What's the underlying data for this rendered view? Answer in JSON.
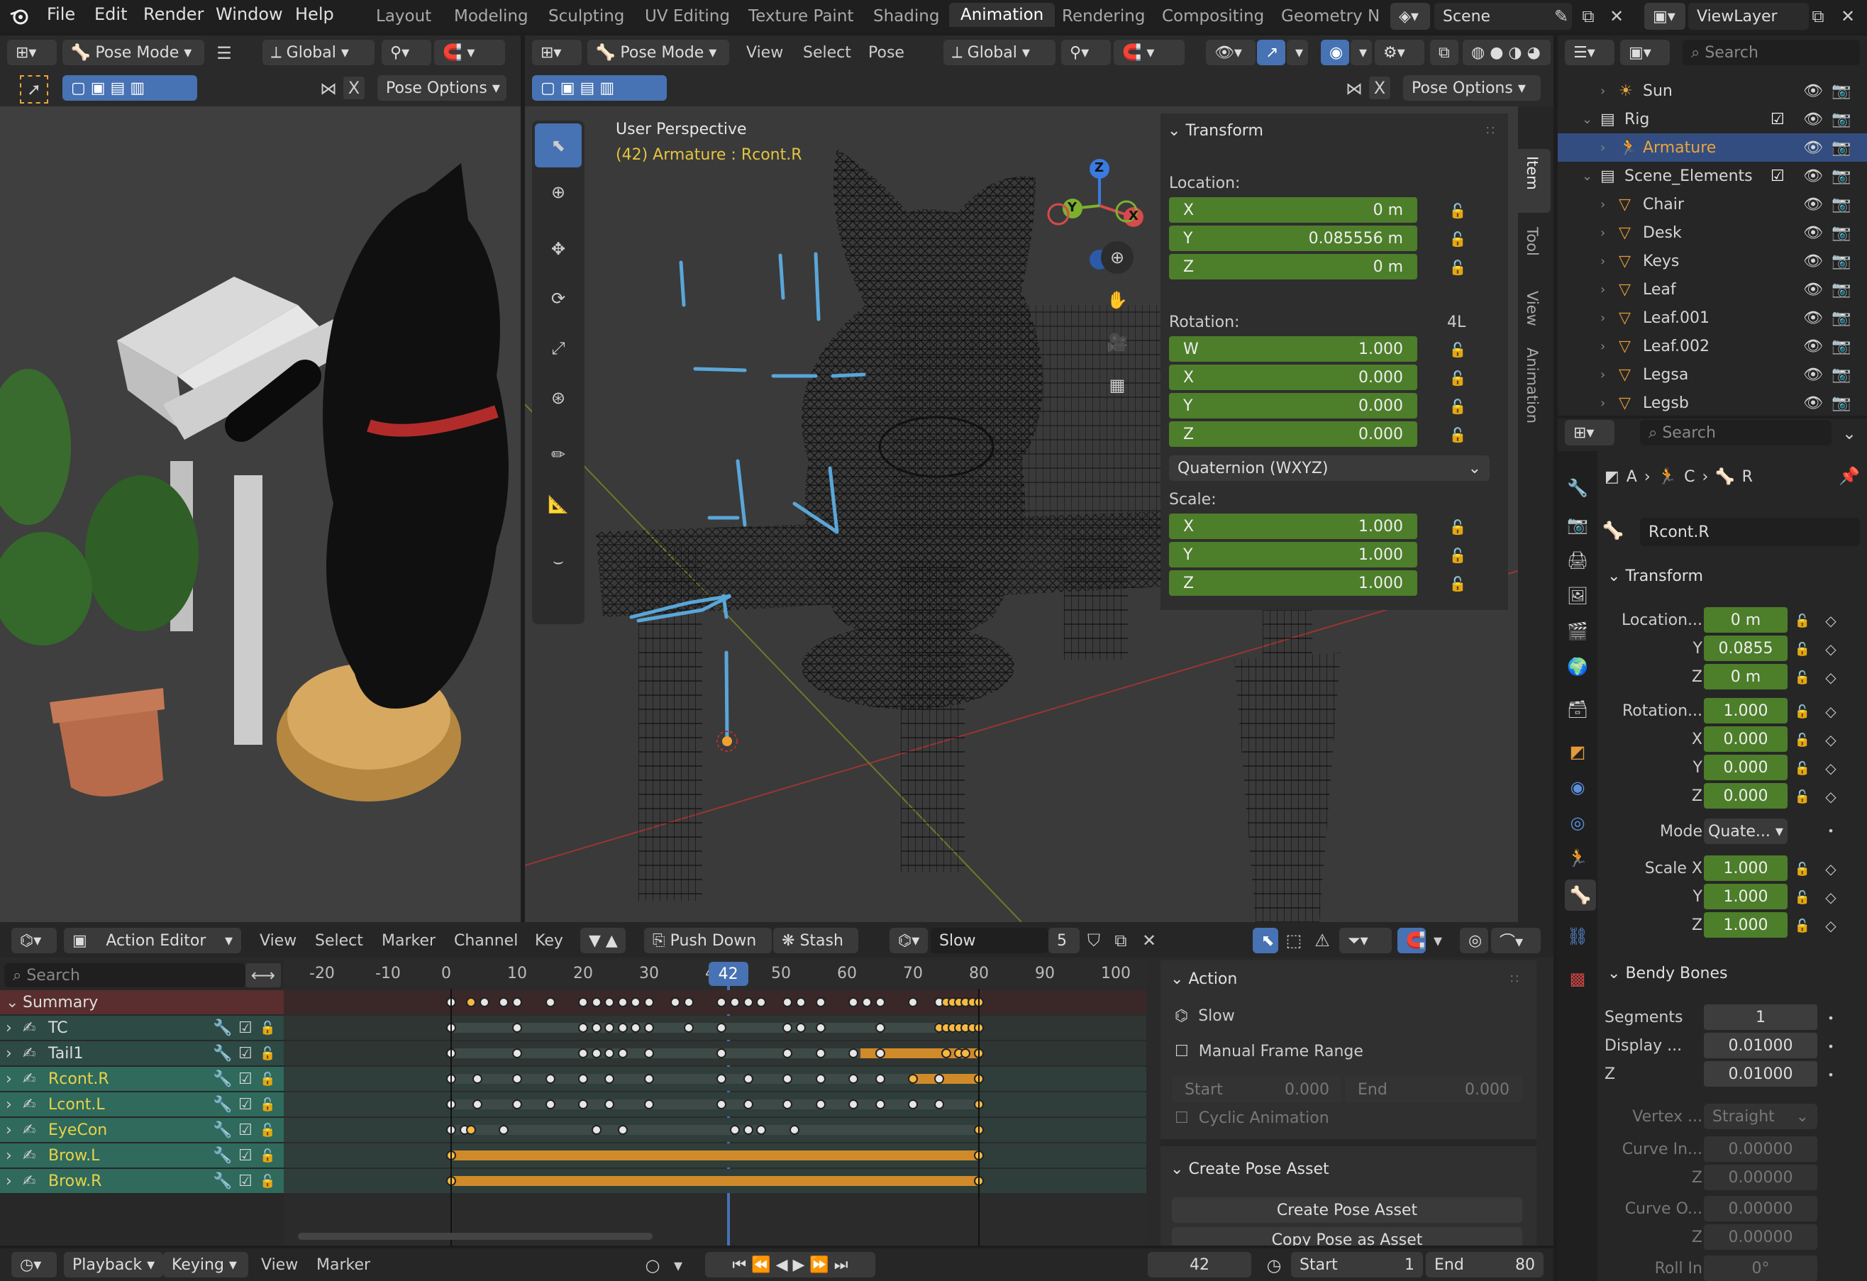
{
  "app": {
    "menus": [
      "File",
      "Edit",
      "Render",
      "Window",
      "Help"
    ],
    "workspaces": [
      "Layout",
      "Modeling",
      "Sculpting",
      "UV Editing",
      "Texture Paint",
      "Shading",
      "Animation",
      "Rendering",
      "Compositing",
      "Geometry Noc"
    ],
    "active_workspace": "Animation",
    "scene": "Scene",
    "view_layer": "ViewLayer"
  },
  "left_view": {
    "mode": "Pose Mode",
    "orientation": "Global",
    "pose_options": "Pose Options"
  },
  "viewport": {
    "mode": "Pose Mode",
    "menus": [
      "View",
      "Select",
      "Pose"
    ],
    "orientation": "Global",
    "pose_options": "Pose Options",
    "overlay_title": "User Perspective",
    "overlay_sub": "(42) Armature : Rcont.R",
    "gizmo": {
      "x": "X",
      "y": "Y",
      "z": "Z"
    },
    "side_tabs": [
      "Item",
      "Tool",
      "View",
      "Animation"
    ]
  },
  "n_panel": {
    "title": "Transform",
    "location_label": "Location:",
    "location": [
      {
        "axis": "X",
        "value": "0 m"
      },
      {
        "axis": "Y",
        "value": "0.085556 m"
      },
      {
        "axis": "Z",
        "value": "0 m"
      }
    ],
    "rotation_label": "Rotation:",
    "rotation_extra": "4L",
    "rotation": [
      {
        "axis": "W",
        "value": "1.000"
      },
      {
        "axis": "X",
        "value": "0.000"
      },
      {
        "axis": "Y",
        "value": "0.000"
      },
      {
        "axis": "Z",
        "value": "0.000"
      }
    ],
    "rotation_mode": "Quaternion (WXYZ)",
    "scale_label": "Scale:",
    "scale": [
      {
        "axis": "X",
        "value": "1.000"
      },
      {
        "axis": "Y",
        "value": "1.000"
      },
      {
        "axis": "Z",
        "value": "1.000"
      }
    ]
  },
  "outliner": {
    "search": "Search",
    "items": [
      {
        "name": "Sun",
        "indent": 1
      },
      {
        "name": "Rig",
        "indent": 0
      },
      {
        "name": "Armature",
        "indent": 1,
        "selected": true
      },
      {
        "name": "Scene_Elements",
        "indent": 0
      },
      {
        "name": "Chair",
        "indent": 1
      },
      {
        "name": "Desk",
        "indent": 1
      },
      {
        "name": "Keys",
        "indent": 1
      },
      {
        "name": "Leaf",
        "indent": 1
      },
      {
        "name": "Leaf.001",
        "indent": 1
      },
      {
        "name": "Leaf.002",
        "indent": 1
      },
      {
        "name": "Legsa",
        "indent": 1
      },
      {
        "name": "Legsb",
        "indent": 1
      }
    ]
  },
  "properties": {
    "search": "Search",
    "breadcrumb": [
      "A",
      "C",
      "R"
    ],
    "bone_name": "Rcont.R",
    "transform_title": "Transform",
    "location": [
      {
        "label": "Location...",
        "value": "0 m"
      },
      {
        "label": "Y",
        "value": "0.0855"
      },
      {
        "label": "Z",
        "value": "0 m"
      }
    ],
    "rotation": [
      {
        "label": "Rotation...",
        "value": "1.000"
      },
      {
        "label": "X",
        "value": "0.000"
      },
      {
        "label": "Y",
        "value": "0.000"
      },
      {
        "label": "Z",
        "value": "0.000"
      }
    ],
    "mode_label": "Mode",
    "mode_value": "Quate...",
    "scale": [
      {
        "label": "Scale X",
        "value": "1.000"
      },
      {
        "label": "Y",
        "value": "1.000"
      },
      {
        "label": "Z",
        "value": "1.000"
      }
    ],
    "bendy_title": "Bendy Bones",
    "bendy": [
      {
        "label": "Segments",
        "value": "1"
      },
      {
        "label": "Display ...",
        "value": "0.01000"
      },
      {
        "label": "Z",
        "value": "0.01000"
      }
    ],
    "vertex_label": "Vertex ...",
    "vertex_value": "Straight",
    "curve_in": [
      {
        "label": "Curve In...",
        "value": "0.00000"
      },
      {
        "label": "Z",
        "value": "0.00000"
      }
    ],
    "curve_out": [
      {
        "label": "Curve O...",
        "value": "0.00000"
      },
      {
        "label": "Z",
        "value": "0.00000"
      }
    ],
    "roll_label": "Roll In",
    "roll_value": "0°"
  },
  "action_editor": {
    "editor": "Action Editor",
    "menus": [
      "View",
      "Select",
      "Marker",
      "Channel",
      "Key"
    ],
    "push_down": "Push Down",
    "stash": "Stash",
    "action": "Slow",
    "users": "5",
    "search": "Search",
    "ruler": [
      "-20",
      "-10",
      "0",
      "10",
      "20",
      "30",
      "40",
      "50",
      "60",
      "70",
      "80",
      "90",
      "100"
    ],
    "current_frame": "42",
    "channels": [
      {
        "name": "Summary"
      },
      {
        "name": "TC"
      },
      {
        "name": "Tail1"
      },
      {
        "name": "Rcont.R"
      },
      {
        "name": "Lcont.L"
      },
      {
        "name": "EyeCon"
      },
      {
        "name": "Brow.L"
      },
      {
        "name": "Brow.R"
      }
    ],
    "panel": {
      "title": "Action",
      "action_name": "Slow",
      "manual_range": "Manual Frame Range",
      "start_label": "Start",
      "start_value": "0.000",
      "end_label": "End",
      "end_value": "0.000",
      "cyclic": "Cyclic Animation",
      "pose_title": "Create Pose Asset",
      "create_btn": "Create Pose Asset",
      "copy_btn": "Copy Pose as Asset"
    }
  },
  "timeline": {
    "menus": [
      "Playback",
      "Keying",
      "View",
      "Marker"
    ],
    "frame": "42",
    "start_label": "Start",
    "start": "1",
    "end_label": "End",
    "end": "80"
  },
  "colors": {
    "accent": "#4772b3",
    "green_field": "#4d7e2a",
    "keyframe": "#f5b942",
    "selected_channel": "#2f6a5c"
  }
}
